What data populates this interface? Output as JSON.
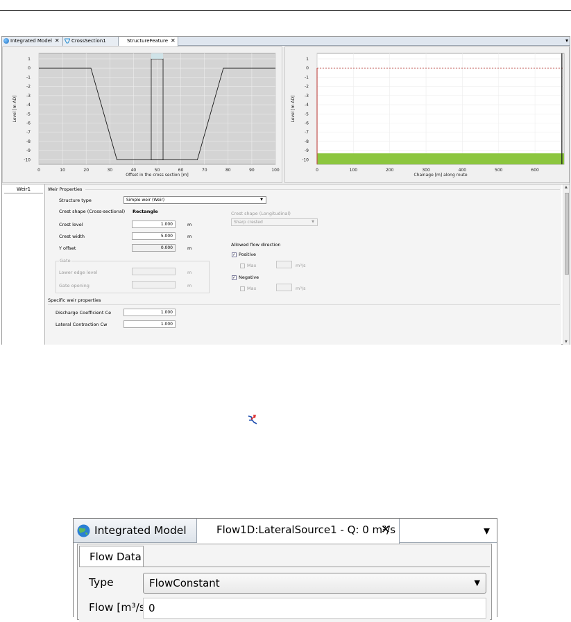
{
  "top_window": {
    "tabs": [
      {
        "label": "Integrated Model",
        "icon": "globe-icon",
        "closable": true,
        "active": false
      },
      {
        "label": "CrossSection1",
        "icon": "cross-section-icon",
        "closable": false,
        "active": false
      },
      {
        "label": "StructureFeature",
        "icon": "",
        "closable": true,
        "active": true
      }
    ],
    "tab_menu_glyph": "▾",
    "close_glyph": "✕",
    "cross_section_chart": {
      "xlabel": "Offset in the cross section [m]",
      "ylabel": "Level [m AD]",
      "xticks": [
        "0",
        "10",
        "20",
        "30",
        "40",
        "50",
        "60",
        "70",
        "80",
        "90",
        "100"
      ],
      "yticks": [
        "1",
        "0",
        "-1",
        "-2",
        "-3",
        "-4",
        "-5",
        "-6",
        "-7",
        "-8",
        "-9",
        "-10"
      ]
    },
    "longitudinal_chart": {
      "xlabel": "Chainage [m] along route",
      "ylabel": "Level [m AD]",
      "xticks": [
        "0",
        "100",
        "200",
        "300",
        "400",
        "500",
        "600"
      ],
      "yticks": [
        "1",
        "0",
        "-1",
        "-2",
        "-3",
        "-4",
        "-5",
        "-6",
        "-7",
        "-8",
        "-9",
        "-10"
      ]
    },
    "side_tab": "Weir1",
    "weir_properties": {
      "section_title": "Weir Properties",
      "structure_type_label": "Structure type",
      "structure_type_value": "Simple weir (Weir)",
      "crest_shape_cross_label": "Crest shape (Cross-sectional)",
      "crest_shape_cross_value": "Rectangle",
      "crest_level_label": "Crest level",
      "crest_level_value": "1.000",
      "crest_width_label": "Crest width",
      "crest_width_value": "5.000",
      "y_offset_label": "Y offset",
      "y_offset_value": "0.000",
      "unit_m": "m",
      "gate_title": "Gate",
      "lower_edge_label": "Lower edge level",
      "gate_opening_label": "Gate opening",
      "crest_shape_long_label": "Crest shape (Longitudinal)",
      "crest_shape_long_value": "Sharp crested",
      "allowed_flow_label": "Allowed flow direction",
      "positive_label": "Positive",
      "negative_label": "Negative",
      "max_label": "Max",
      "flow_unit": "m³/s",
      "check_glyph": "✓"
    },
    "specific_weir": {
      "title": "Specific weir properties",
      "discharge_label": "Discharge Coefficient Ce",
      "discharge_value": "1.000",
      "lateral_label": "Lateral Contraction Cw",
      "lateral_value": "1.000"
    }
  },
  "middle_icon": "lateral-source-icon",
  "bottom_window": {
    "tab_integrated": "Integrated Model",
    "tab_source": "Flow1D:LateralSource1 - Q: 0 m³/s",
    "close_glyph": "✕",
    "menu_glyph": "▾",
    "subtab": "Flow Data",
    "type_label": "Type",
    "type_value": "FlowConstant",
    "flow_label": "Flow [m³/s]",
    "flow_value": "0"
  },
  "colors": {
    "plot_bg": "#d4d4d4",
    "longitudinal_bed": "#8cc63f",
    "water_level_dashed": "#c0504d"
  }
}
